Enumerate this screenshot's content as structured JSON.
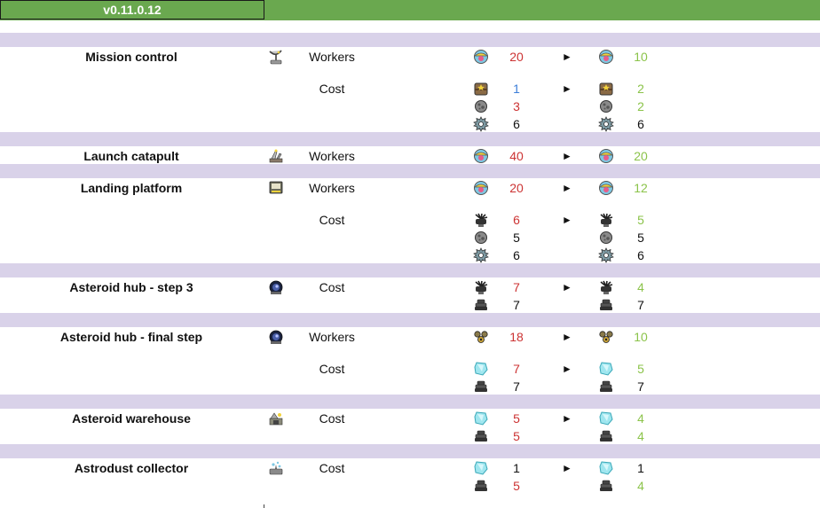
{
  "version": "v0.11.0.12",
  "colors": {
    "header_green": "#6aa84f",
    "band_lavender": "#d9d2e9",
    "worse_red": "#cc3333",
    "better_green": "#8bc34a",
    "neutral_blue": "#3d7fd9",
    "neutral_black": "#111111"
  },
  "arrow_glyph": "►",
  "buildings": [
    {
      "name": "Mission control",
      "icon": "mission-control-icon",
      "groups": [
        {
          "type": "Workers",
          "rows": [
            {
              "resource": "worker-icon",
              "old": "20",
              "old_color": "red",
              "new": "10",
              "new_color": "green"
            }
          ]
        },
        {
          "type": "Cost",
          "rows": [
            {
              "resource": "crate-icon",
              "old": "1",
              "old_color": "blue",
              "new": "2",
              "new_color": "green"
            },
            {
              "resource": "ore-icon",
              "old": "3",
              "old_color": "red",
              "new": "2",
              "new_color": "green"
            },
            {
              "resource": "gear-icon",
              "old": "6",
              "old_color": "black",
              "new": "6",
              "new_color": "black"
            }
          ]
        }
      ]
    },
    {
      "name": "Launch catapult",
      "icon": "catapult-icon",
      "groups": [
        {
          "type": "Workers",
          "rows": [
            {
              "resource": "worker-icon",
              "old": "40",
              "old_color": "red",
              "new": "20",
              "new_color": "green"
            }
          ]
        }
      ]
    },
    {
      "name": "Landing platform",
      "icon": "landing-platform-icon",
      "groups": [
        {
          "type": "Workers",
          "rows": [
            {
              "resource": "worker-icon",
              "old": "20",
              "old_color": "red",
              "new": "12",
              "new_color": "green"
            }
          ]
        },
        {
          "type": "Cost",
          "rows": [
            {
              "resource": "cable-icon",
              "old": "6",
              "old_color": "red",
              "new": "5",
              "new_color": "green"
            },
            {
              "resource": "ore-icon",
              "old": "5",
              "old_color": "black",
              "new": "5",
              "new_color": "black"
            },
            {
              "resource": "gear-icon",
              "old": "6",
              "old_color": "black",
              "new": "6",
              "new_color": "black"
            }
          ]
        }
      ]
    },
    {
      "name": "Asteroid hub - step 3",
      "icon": "asteroid-hub-icon",
      "groups": [
        {
          "type": "Cost",
          "rows": [
            {
              "resource": "cable-icon",
              "old": "7",
              "old_color": "red",
              "new": "4",
              "new_color": "green"
            },
            {
              "resource": "plate-stack-icon",
              "old": "7",
              "old_color": "black",
              "new": "7",
              "new_color": "black"
            }
          ]
        }
      ]
    },
    {
      "name": "Asteroid hub - final step",
      "icon": "asteroid-hub-icon",
      "groups": [
        {
          "type": "Workers",
          "rows": [
            {
              "resource": "robot-workers-icon",
              "old": "18",
              "old_color": "red",
              "new": "10",
              "new_color": "green"
            }
          ]
        },
        {
          "type": "Cost",
          "rows": [
            {
              "resource": "crystal-icon",
              "old": "7",
              "old_color": "red",
              "new": "5",
              "new_color": "green"
            },
            {
              "resource": "plate-stack-icon",
              "old": "7",
              "old_color": "black",
              "new": "7",
              "new_color": "black"
            }
          ]
        }
      ]
    },
    {
      "name": "Asteroid warehouse",
      "icon": "warehouse-icon",
      "groups": [
        {
          "type": "Cost",
          "rows": [
            {
              "resource": "crystal-icon",
              "old": "5",
              "old_color": "red",
              "new": "4",
              "new_color": "green"
            },
            {
              "resource": "plate-stack-icon",
              "old": "5",
              "old_color": "red",
              "new": "4",
              "new_color": "green"
            }
          ]
        }
      ]
    },
    {
      "name": "Astrodust collector",
      "icon": "astrodust-collector-icon",
      "groups": [
        {
          "type": "Cost",
          "rows": [
            {
              "resource": "crystal-icon",
              "old": "1",
              "old_color": "black",
              "new": "1",
              "new_color": "black"
            },
            {
              "resource": "plate-stack-icon",
              "old": "5",
              "old_color": "red",
              "new": "4",
              "new_color": "green"
            }
          ]
        }
      ]
    }
  ]
}
